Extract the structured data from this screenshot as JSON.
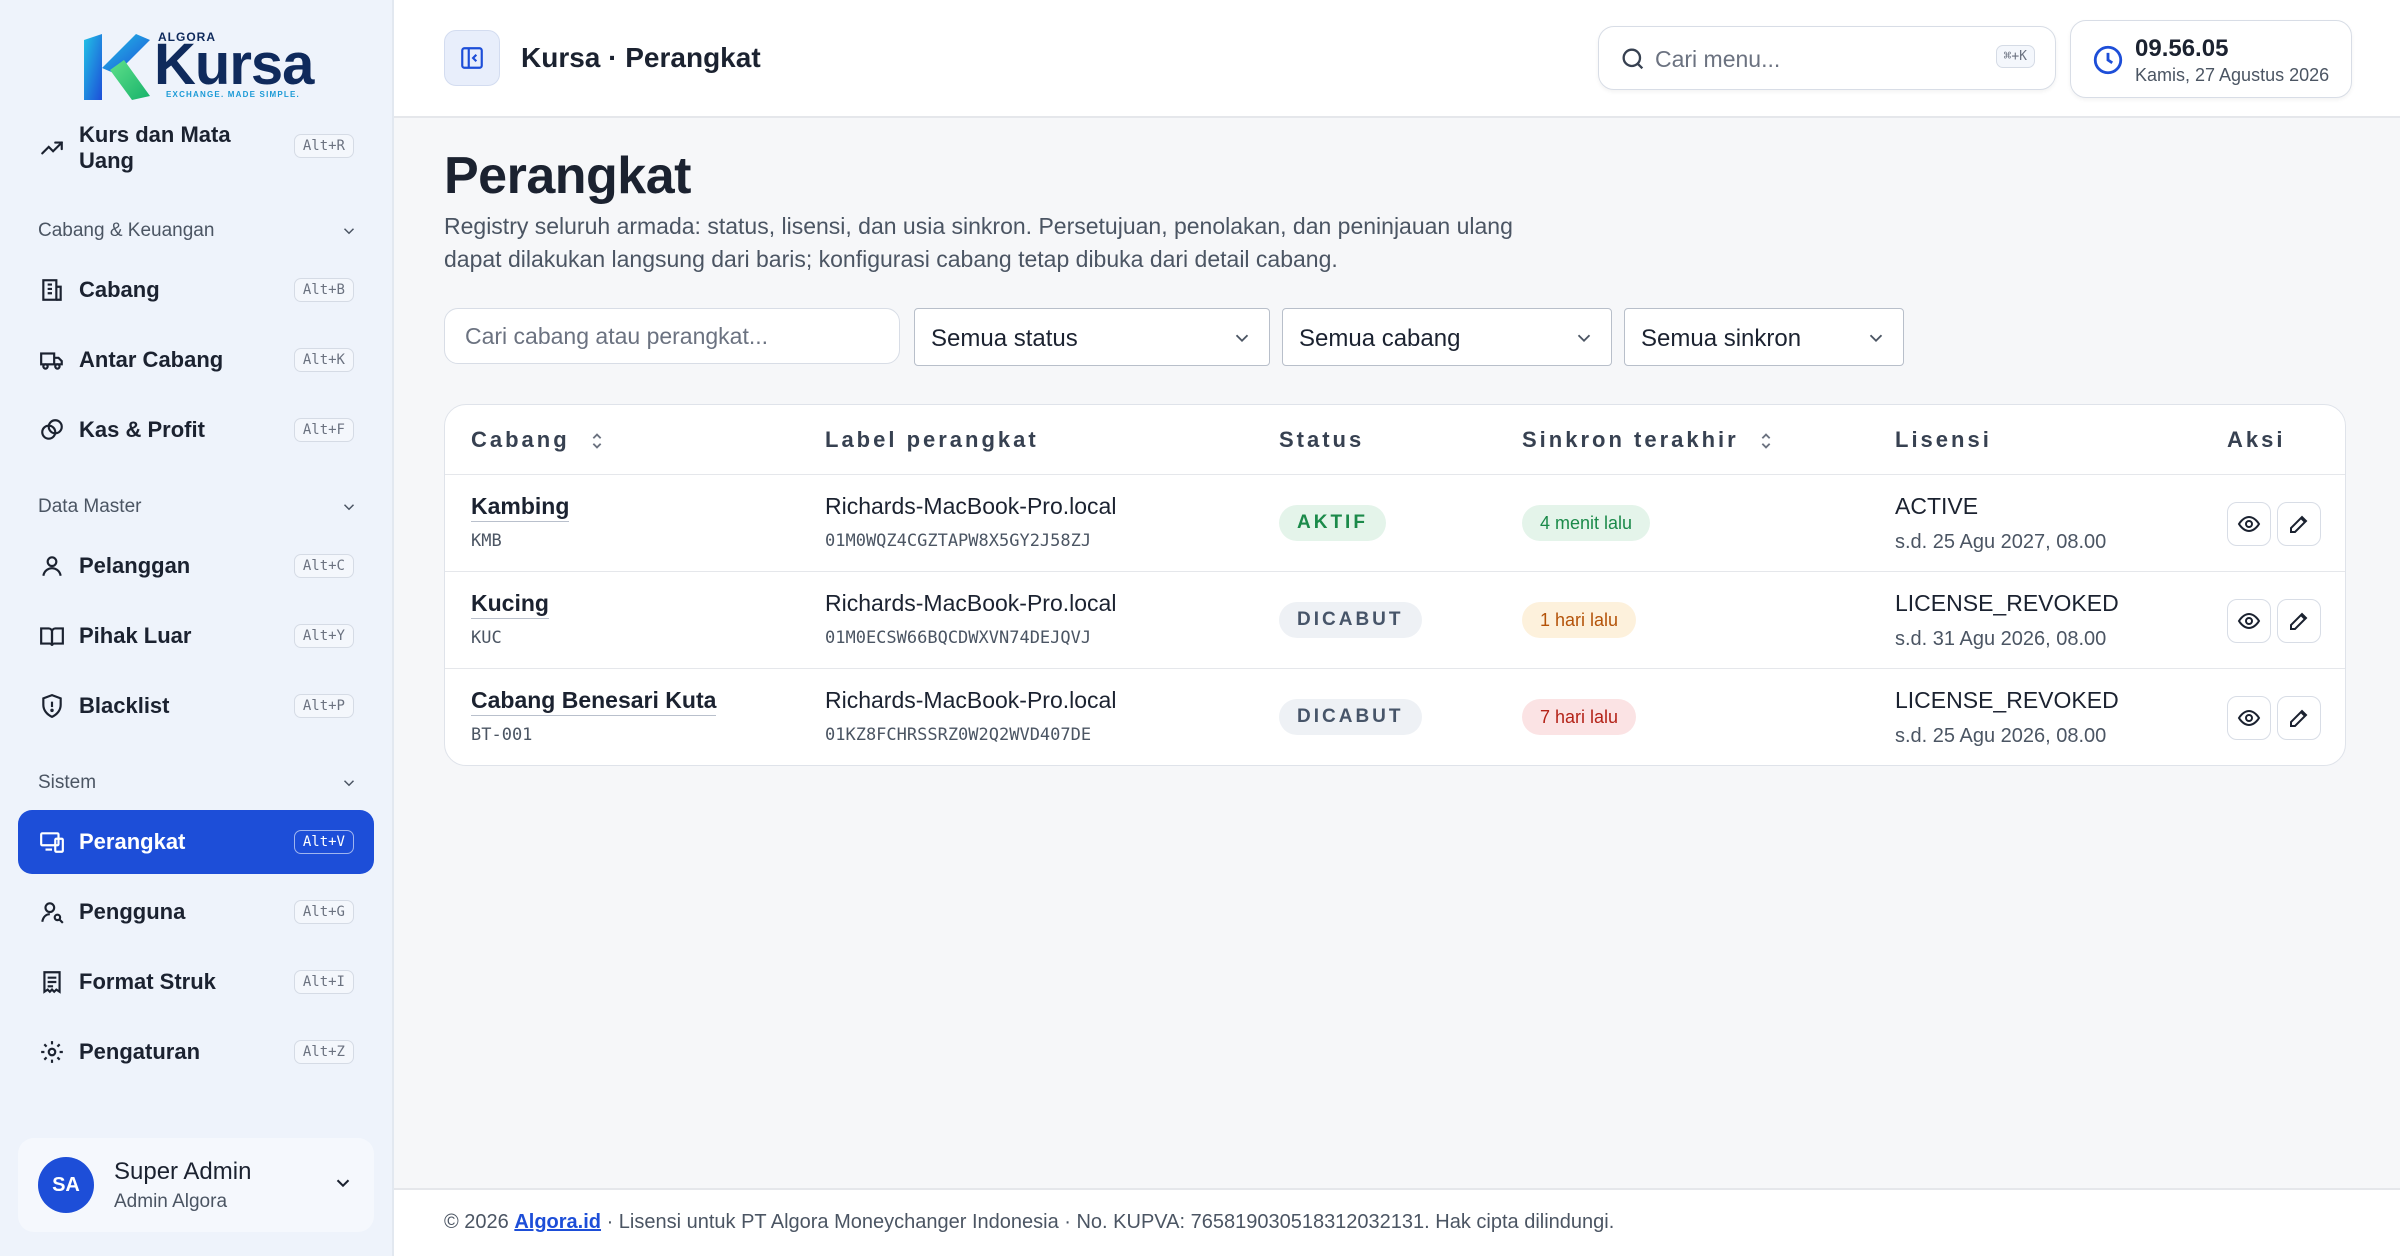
{
  "brand": {
    "top_label": "ALGORA",
    "name": "Kursa",
    "tagline": "EXCHANGE. MADE SIMPLE."
  },
  "sidebar": {
    "partial_item": {
      "label_line1": "Kurs dan Mata",
      "label_line2": "Uang",
      "shortcut": "Alt+R"
    },
    "sections": [
      {
        "title": "Cabang & Keuangan",
        "items": [
          {
            "label": "Cabang",
            "shortcut": "Alt+B"
          },
          {
            "label": "Antar Cabang",
            "shortcut": "Alt+K"
          },
          {
            "label": "Kas & Profit",
            "shortcut": "Alt+F"
          }
        ]
      },
      {
        "title": "Data Master",
        "items": [
          {
            "label": "Pelanggan",
            "shortcut": "Alt+C"
          },
          {
            "label": "Pihak Luar",
            "shortcut": "Alt+Y"
          },
          {
            "label": "Blacklist",
            "shortcut": "Alt+P"
          }
        ]
      },
      {
        "title": "Sistem",
        "items": [
          {
            "label": "Perangkat",
            "shortcut": "Alt+V"
          },
          {
            "label": "Pengguna",
            "shortcut": "Alt+G"
          },
          {
            "label": "Format Struk",
            "shortcut": "Alt+I"
          },
          {
            "label": "Pengaturan",
            "shortcut": "Alt+Z"
          }
        ]
      }
    ],
    "active_item": "Perangkat",
    "user": {
      "initials": "SA",
      "name": "Super Admin",
      "role": "Admin Algora"
    }
  },
  "header": {
    "breadcrumb": "Kursa · Perangkat",
    "search_placeholder": "Cari menu...",
    "search_shortcut": "⌘+K",
    "time": "09.56.05",
    "date": "Kamis, 27 Agustus 2026"
  },
  "main": {
    "title": "Perangkat",
    "description": "Registry seluruh armada: status, lisensi, dan usia sinkron. Persetujuan, penolakan, dan peninjauan ulang dapat dilakukan langsung dari baris; konfigurasi cabang tetap dibuka dari detail cabang.",
    "filters": {
      "search_placeholder": "Cari cabang atau perangkat...",
      "status": "Semua status",
      "branch": "Semua cabang",
      "sync": "Semua sinkron"
    },
    "table": {
      "columns": [
        "Cabang",
        "Label perangkat",
        "Status",
        "Sinkron terakhir",
        "Lisensi",
        "Aksi"
      ],
      "rows": [
        {
          "branch": "Kambing",
          "code": "KMB",
          "device": "Richards-MacBook-Pro.local",
          "device_id": "01M0WQZ4CGZTAPW8X5GY2J58ZJ",
          "status": "AKTIF",
          "sync": "4 menit lalu",
          "license": "ACTIVE",
          "license_until": "s.d. 25 Agu 2027, 08.00"
        },
        {
          "branch": "Kucing",
          "code": "KUC",
          "device": "Richards-MacBook-Pro.local",
          "device_id": "01M0ECSW66BQCDWXVN74DEJQVJ",
          "status": "DICABUT",
          "sync": "1 hari lalu",
          "license": "LICENSE_REVOKED",
          "license_until": "s.d. 31 Agu 2026, 08.00"
        },
        {
          "branch": "Cabang Benesari Kuta",
          "code": "BT-001",
          "device": "Richards-MacBook-Pro.local",
          "device_id": "01KZ8FCHRSSRZ0W2Q2WVD407DE",
          "status": "DICABUT",
          "sync": "7 hari lalu",
          "license": "LICENSE_REVOKED",
          "license_until": "s.d. 25 Agu 2026, 08.00"
        }
      ]
    }
  },
  "footer": {
    "prefix": "© 2026 ",
    "link": "Algora.id",
    "suffix": " · Lisensi untuk PT Algora Moneychanger Indonesia · No. KUPVA: 7658190305183120321​31. Hak cipta dilindungi."
  },
  "colors": {
    "accent": "#1d4ed8",
    "success": "#1b8a4a",
    "warning": "#b45309",
    "danger": "#b42318"
  }
}
